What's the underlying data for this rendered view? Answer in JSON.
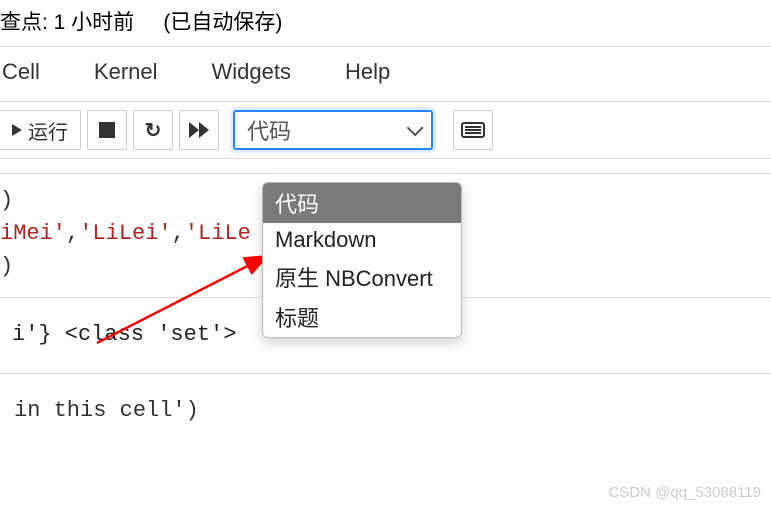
{
  "header": {
    "checkpoint_label": "查点: 1 小时前",
    "autosave_label": "(已自动保存)"
  },
  "menu": {
    "cell": "Cell",
    "kernel": "Kernel",
    "widgets": "Widgets",
    "help": "Help"
  },
  "toolbar": {
    "run_label": "运行",
    "cell_type_selected": "代码",
    "cell_type_options": {
      "code": "代码",
      "markdown": "Markdown",
      "nbconvert": "原生 NBConvert",
      "heading": "标题"
    }
  },
  "code": {
    "line1_close": ")",
    "line2_str1": "iMei",
    "line2_str2": "LiLei",
    "line2_str3": "LiLe",
    "line3_close": ")",
    "output_frag1": "i'} <class 'set'>",
    "bottom_frag": "in this cell')"
  },
  "watermark": "CSDN @qq_53088119"
}
